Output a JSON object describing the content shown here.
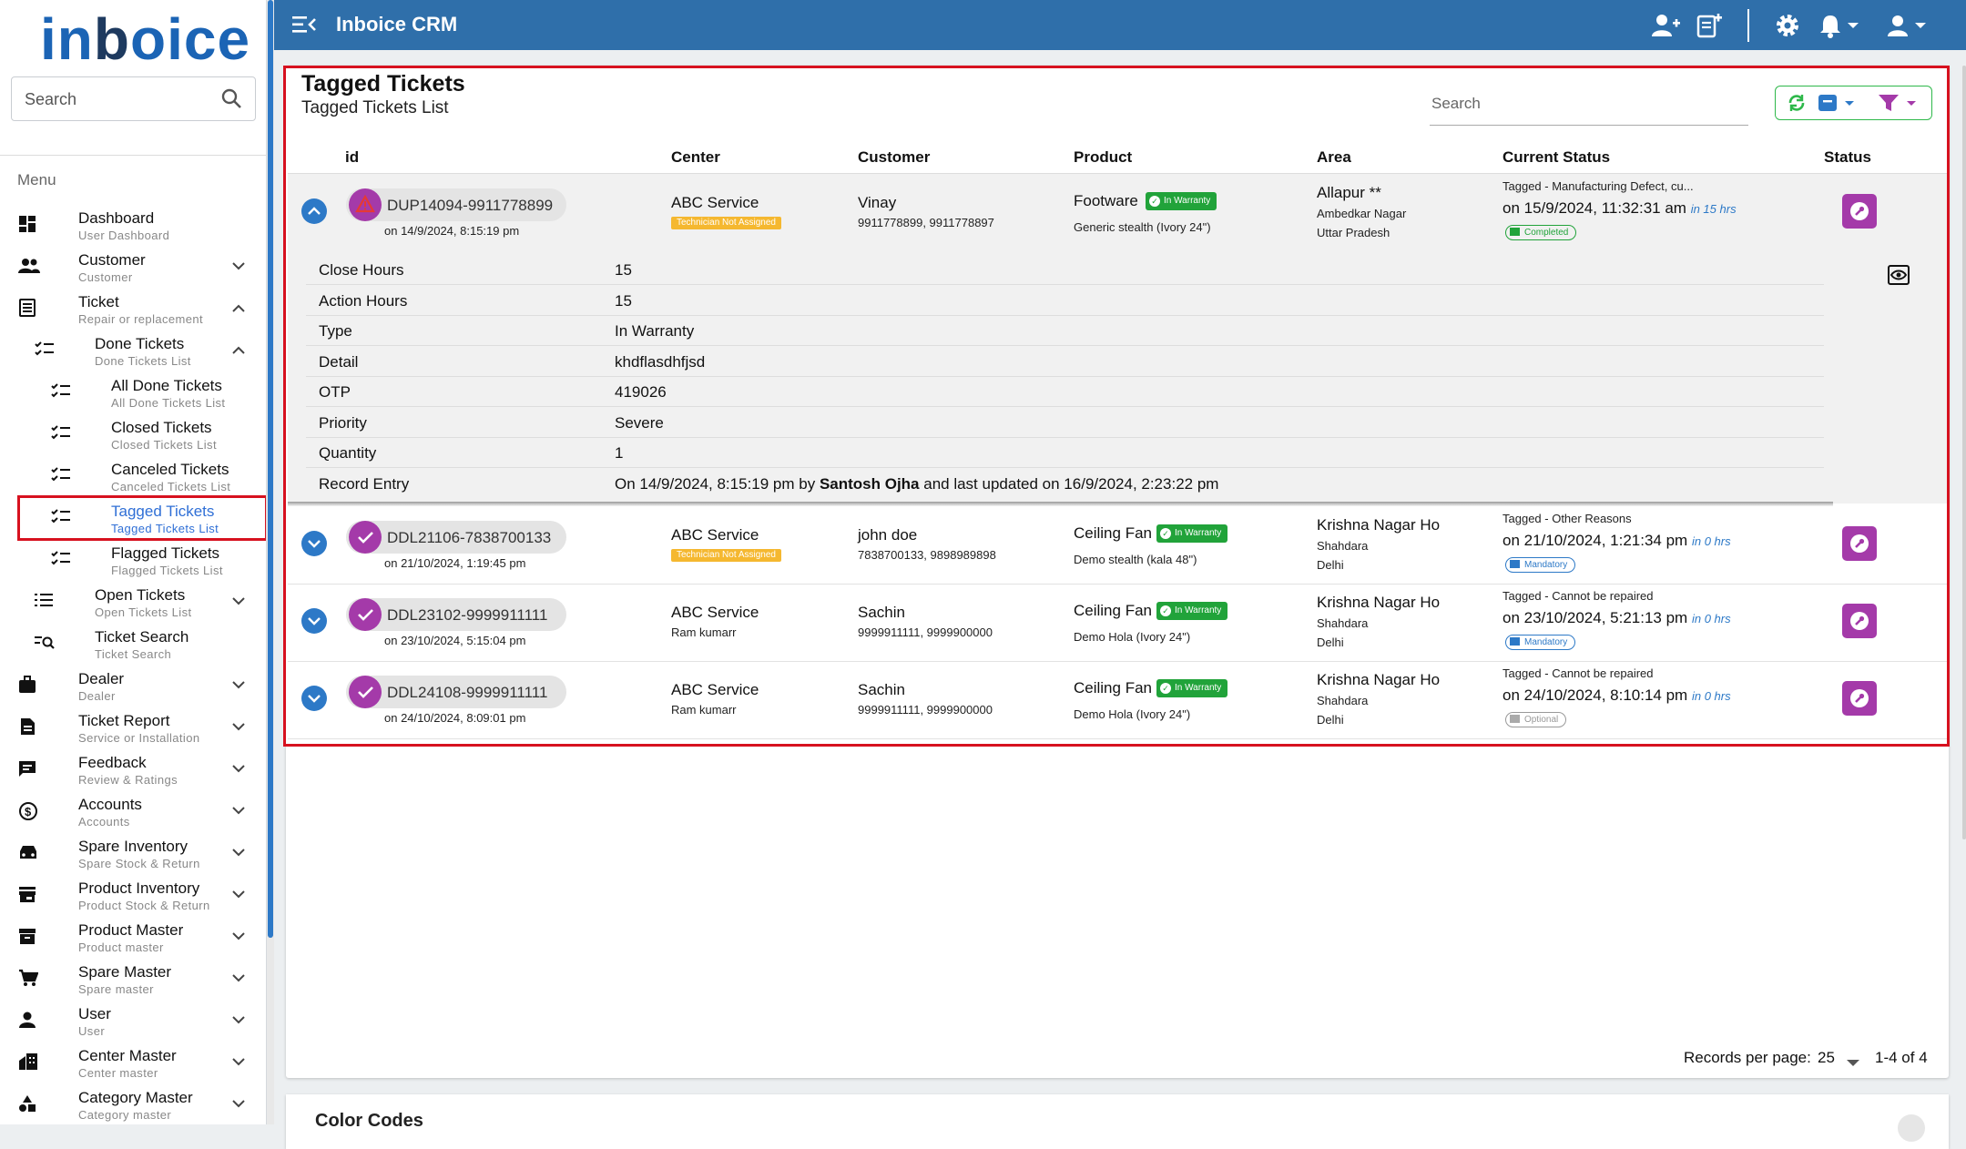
{
  "logo": {
    "part1": "in",
    "part2": "b",
    "part3": "oice"
  },
  "sidebar": {
    "search_placeholder": "Search",
    "menu_label": "Menu",
    "items": [
      {
        "title": "Dashboard",
        "sub": "User Dashboard",
        "icon": "dashboard-icon",
        "chev": ""
      },
      {
        "title": "Customer",
        "sub": "Customer",
        "icon": "people-icon",
        "chev": "down"
      },
      {
        "title": "Ticket",
        "sub": "Repair or replacement",
        "icon": "ticket-icon",
        "chev": "up"
      },
      {
        "title": "Done Tickets",
        "sub": "Done Tickets List",
        "icon": "checklist-icon",
        "chev": "up"
      },
      {
        "title": "All Done Tickets",
        "sub": "All Done Tickets List",
        "icon": "checklist-icon",
        "chev": ""
      },
      {
        "title": "Closed Tickets",
        "sub": "Closed Tickets List",
        "icon": "checklist-icon",
        "chev": ""
      },
      {
        "title": "Canceled Tickets",
        "sub": "Canceled Tickets List",
        "icon": "checklist-icon",
        "chev": ""
      },
      {
        "title": "Tagged Tickets",
        "sub": "Tagged Tickets List",
        "icon": "checklist-icon",
        "chev": ""
      },
      {
        "title": "Flagged Tickets",
        "sub": "Flagged Tickets List",
        "icon": "checklist-icon",
        "chev": ""
      },
      {
        "title": "Open Tickets",
        "sub": "Open Tickets List",
        "icon": "list-icon",
        "chev": "down"
      },
      {
        "title": "Ticket Search",
        "sub": "Ticket Search",
        "icon": "search-list-icon",
        "chev": ""
      },
      {
        "title": "Dealer",
        "sub": "Dealer",
        "icon": "briefcase-icon",
        "chev": "down"
      },
      {
        "title": "Ticket Report",
        "sub": "Service or Installation",
        "icon": "report-icon",
        "chev": "down"
      },
      {
        "title": "Feedback",
        "sub": "Review & Ratings",
        "icon": "feedback-icon",
        "chev": "down"
      },
      {
        "title": "Accounts",
        "sub": "Accounts",
        "icon": "currency-icon",
        "chev": "down"
      },
      {
        "title": "Spare Inventory",
        "sub": "Spare Stock & Return",
        "icon": "car-icon",
        "chev": "down"
      },
      {
        "title": "Product Inventory",
        "sub": "Product Stock & Return",
        "icon": "store-icon",
        "chev": "down"
      },
      {
        "title": "Product Master",
        "sub": "Product master",
        "icon": "archive-icon",
        "chev": "down"
      },
      {
        "title": "Spare Master",
        "sub": "Spare master",
        "icon": "cart-icon",
        "chev": "down"
      },
      {
        "title": "User",
        "sub": "User",
        "icon": "user-icon",
        "chev": "down"
      },
      {
        "title": "Center Master",
        "sub": "Center master",
        "icon": "building-icon",
        "chev": "down"
      },
      {
        "title": "Category Master",
        "sub": "Category master",
        "icon": "shapes-icon",
        "chev": "down"
      }
    ]
  },
  "topbar": {
    "title": "Inboice CRM"
  },
  "page": {
    "title": "Tagged Tickets",
    "subtitle": "Tagged Tickets List",
    "search_placeholder": "Search"
  },
  "columns": [
    "id",
    "Center",
    "Customer",
    "Product",
    "Area",
    "Current Status",
    "Status"
  ],
  "tickets": [
    {
      "id": "DUP14094-9911778899",
      "date": "on 14/9/2024, 8:15:19 pm",
      "avatar": "warning-icon",
      "center": "ABC Service",
      "center_sub": "Technician Not Assigned",
      "customer": "Vinay",
      "phones": "9911778899, 9911778897",
      "product": "Footware",
      "warranty": "In Warranty",
      "model": "Generic stealth (Ivory 24\")",
      "area": "Allapur **",
      "area2": "Ambedkar Nagar",
      "area3": "Uttar Pradesh",
      "status_head": "Tagged - Manufacturing Defect, cu...",
      "status_date": "on 15/9/2024, 11:32:31 am",
      "status_ago": "in 15 hrs",
      "status_pill": "Completed"
    },
    {
      "id": "DDL21106-7838700133",
      "date": "on 21/10/2024, 1:19:45 pm",
      "avatar": "check-icon",
      "center": "ABC Service",
      "center_sub": "Technician Not Assigned",
      "customer": "john doe",
      "phones": "7838700133, 9898989898",
      "product": "Ceiling Fan",
      "warranty": "In Warranty",
      "model": "Demo stealth (kala 48\")",
      "area": "Krishna Nagar Ho",
      "area2": "Shahdara",
      "area3": "Delhi",
      "status_head": "Tagged - Other Reasons",
      "status_date": "on 21/10/2024, 1:21:34 pm",
      "status_ago": "in 0 hrs",
      "status_pill": "Mandatory"
    },
    {
      "id": "DDL23102-9999911111",
      "date": "on 23/10/2024, 5:15:04 pm",
      "avatar": "check-icon",
      "center": "ABC Service",
      "center_sub": "Ram kumarr",
      "customer": "Sachin",
      "phones": "9999911111, 9999900000",
      "product": "Ceiling Fan",
      "warranty": "In Warranty",
      "model": "Demo Hola (Ivory 24\")",
      "area": "Krishna Nagar Ho",
      "area2": "Shahdara",
      "area3": "Delhi",
      "status_head": "Tagged - Cannot be repaired",
      "status_date": "on 23/10/2024, 5:21:13 pm",
      "status_ago": "in 0 hrs",
      "status_pill": "Mandatory"
    },
    {
      "id": "DDL24108-9999911111",
      "date": "on 24/10/2024, 8:09:01 pm",
      "avatar": "check-icon",
      "center": "ABC Service",
      "center_sub": "Ram kumarr",
      "customer": "Sachin",
      "phones": "9999911111, 9999900000",
      "product": "Ceiling Fan",
      "warranty": "In Warranty",
      "model": "Demo Hola (Ivory 24\")",
      "area": "Krishna Nagar Ho",
      "area2": "Shahdara",
      "area3": "Delhi",
      "status_head": "Tagged - Cannot be repaired",
      "status_date": "on 24/10/2024, 8:10:14 pm",
      "status_ago": "in 0 hrs",
      "status_pill": "Optional"
    }
  ],
  "details": [
    {
      "key": "Close Hours",
      "value": "15"
    },
    {
      "key": "Action Hours",
      "value": "15"
    },
    {
      "key": "Type",
      "value": "In Warranty"
    },
    {
      "key": "Detail",
      "value": "khdflasdhfjsd"
    },
    {
      "key": "OTP",
      "value": "419026"
    },
    {
      "key": "Priority",
      "value": "Severe"
    },
    {
      "key": "Quantity",
      "value": "1"
    }
  ],
  "record_entry": {
    "label": "Record Entry",
    "prefix": "On 14/9/2024, 8:15:19 pm by ",
    "user": "Santosh Ojha",
    "suffix": " and last updated on 16/9/2024, 2:23:22 pm"
  },
  "footer": {
    "rpp_label": "Records per page:",
    "rpp_value": "25",
    "range": "1-4 of 4"
  },
  "color_codes": {
    "title": "Color Codes"
  },
  "colors": {
    "primary": "#2f6faa",
    "accent": "#a43aa9",
    "success": "#21a33a",
    "warning": "#f5b830",
    "highlight": "#d7111f"
  }
}
